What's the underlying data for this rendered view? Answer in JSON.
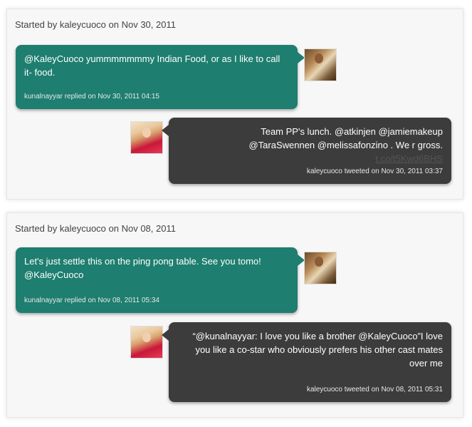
{
  "conversations": [
    {
      "started": "Started by kaleycuoco on Nov 30, 2011",
      "reply": {
        "text": "@KaleyCuoco yummmmmmmy Indian Food, or as I like to call it- food.",
        "meta": "kunalnayyar replied on Nov 30, 2011 04:15",
        "avatar": "kunalnayyar-avatar"
      },
      "tweet": {
        "text": "Team PP's lunch. @atkinjen @jamiemakeup @TaraSwennen @melissafonzino . We r gross.",
        "link": "t.co/t5Kwd6BHS",
        "meta": "kaleycuoco tweeted on Nov 30, 2011 03:37",
        "avatar": "kaleycuoco-avatar"
      }
    },
    {
      "started": "Started by kaleycuoco on Nov 08, 2011",
      "reply": {
        "text": "Let's just settle this on the ping pong table. See you tomo! @KaleyCuoco",
        "meta": "kunalnayyar replied on Nov 08, 2011 05:34",
        "avatar": "kunalnayyar-avatar"
      },
      "tweet": {
        "text": "“@kunalnayyar: I love you like a brother @KaleyCuoco”I love you like a co-star who obviously prefers his other cast mates over me",
        "meta": "kaleycuoco tweeted on Nov 08, 2011 05:31",
        "avatar": "kaleycuoco-avatar"
      }
    }
  ],
  "colors": {
    "reply_bubble": "#1e7e6f",
    "tweet_bubble": "#3c3c3c",
    "panel_bg": "#f7f7f7"
  }
}
